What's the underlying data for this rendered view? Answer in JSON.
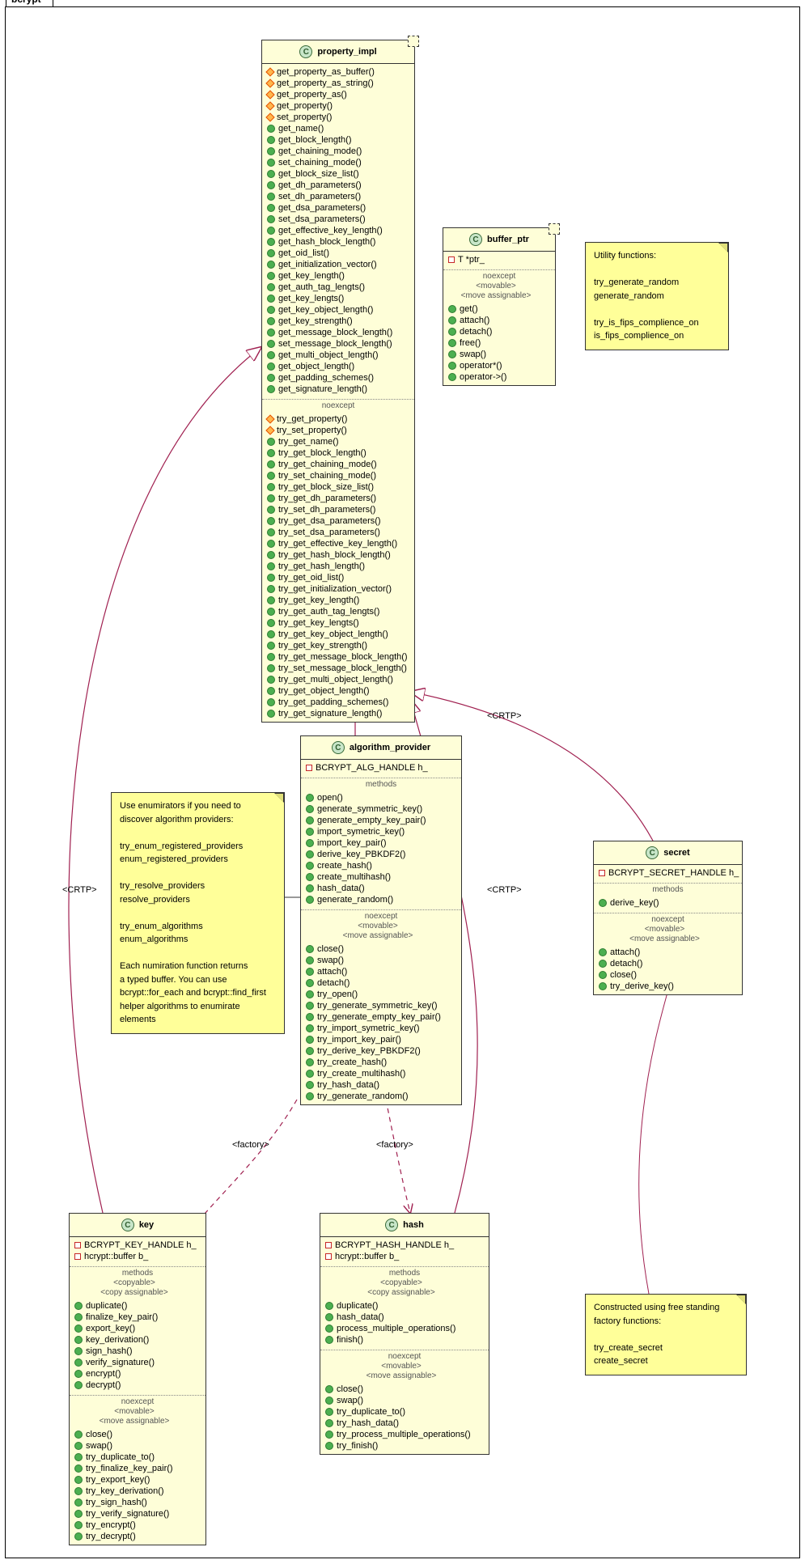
{
  "package": {
    "name": "bcrypt"
  },
  "classes": {
    "property_impl": {
      "name": "property_impl",
      "members1": [
        {
          "v": "protected",
          "t": "get_property_as_buffer()"
        },
        {
          "v": "protected",
          "t": "get_property_as_string()"
        },
        {
          "v": "protected",
          "t": "get_property_as()"
        },
        {
          "v": "protected",
          "t": "get_property()"
        },
        {
          "v": "protected",
          "t": "set_property()"
        },
        {
          "v": "public",
          "t": "get_name()"
        },
        {
          "v": "public",
          "t": "get_block_length()"
        },
        {
          "v": "public",
          "t": "get_chaining_mode()"
        },
        {
          "v": "public",
          "t": "set_chaining_mode()"
        },
        {
          "v": "public",
          "t": "get_block_size_list()"
        },
        {
          "v": "public",
          "t": "get_dh_parameters()"
        },
        {
          "v": "public",
          "t": "set_dh_parameters()"
        },
        {
          "v": "public",
          "t": "get_dsa_parameters()"
        },
        {
          "v": "public",
          "t": "set_dsa_parameters()"
        },
        {
          "v": "public",
          "t": "get_effective_key_length()"
        },
        {
          "v": "public",
          "t": "get_hash_block_length()"
        },
        {
          "v": "public",
          "t": "get_oid_list()"
        },
        {
          "v": "public",
          "t": "get_initialization_vector()"
        },
        {
          "v": "public",
          "t": "get_key_length()"
        },
        {
          "v": "public",
          "t": "get_auth_tag_lengts()"
        },
        {
          "v": "public",
          "t": "get_key_lengts()"
        },
        {
          "v": "public",
          "t": "get_key_object_length()"
        },
        {
          "v": "public",
          "t": "get_key_strength()"
        },
        {
          "v": "public",
          "t": "get_message_block_length()"
        },
        {
          "v": "public",
          "t": "set_message_block_length()"
        },
        {
          "v": "public",
          "t": "get_multi_object_length()"
        },
        {
          "v": "public",
          "t": "get_object_length()"
        },
        {
          "v": "public",
          "t": "get_padding_schemes()"
        },
        {
          "v": "public",
          "t": "get_signature_length()"
        }
      ],
      "sec1_label": "noexcept",
      "members2": [
        {
          "v": "protected",
          "t": "try_get_property()"
        },
        {
          "v": "protected",
          "t": "try_set_property()"
        },
        {
          "v": "public",
          "t": "try_get_name()"
        },
        {
          "v": "public",
          "t": "try_get_block_length()"
        },
        {
          "v": "public",
          "t": "try_get_chaining_mode()"
        },
        {
          "v": "public",
          "t": "try_set_chaining_mode()"
        },
        {
          "v": "public",
          "t": "try_get_block_size_list()"
        },
        {
          "v": "public",
          "t": "try_get_dh_parameters()"
        },
        {
          "v": "public",
          "t": "try_set_dh_parameters()"
        },
        {
          "v": "public",
          "t": "try_get_dsa_parameters()"
        },
        {
          "v": "public",
          "t": "try_set_dsa_parameters()"
        },
        {
          "v": "public",
          "t": "try_get_effective_key_length()"
        },
        {
          "v": "public",
          "t": "try_get_hash_block_length()"
        },
        {
          "v": "public",
          "t": "try_get_hash_length()"
        },
        {
          "v": "public",
          "t": "try_get_oid_list()"
        },
        {
          "v": "public",
          "t": "try_get_initialization_vector()"
        },
        {
          "v": "public",
          "t": "try_get_key_length()"
        },
        {
          "v": "public",
          "t": "try_get_auth_tag_lengts()"
        },
        {
          "v": "public",
          "t": "try_get_key_lengts()"
        },
        {
          "v": "public",
          "t": "try_get_key_object_length()"
        },
        {
          "v": "public",
          "t": "try_get_key_strength()"
        },
        {
          "v": "public",
          "t": "try_get_message_block_length()"
        },
        {
          "v": "public",
          "t": "try_set_message_block_length()"
        },
        {
          "v": "public",
          "t": "try_get_multi_object_length()"
        },
        {
          "v": "public",
          "t": "try_get_object_length()"
        },
        {
          "v": "public",
          "t": "try_get_padding_schemes()"
        },
        {
          "v": "public",
          "t": "try_get_signature_length()"
        }
      ]
    },
    "buffer_ptr": {
      "name": "buffer_ptr",
      "attrs": [
        {
          "v": "private",
          "t": "T *ptr_"
        }
      ],
      "sec_label": "noexcept",
      "stereo": [
        "<movable>",
        "<move assignable>"
      ],
      "methods": [
        {
          "v": "public",
          "t": "get()"
        },
        {
          "v": "public",
          "t": "attach()"
        },
        {
          "v": "public",
          "t": "detach()"
        },
        {
          "v": "public",
          "t": "free()"
        },
        {
          "v": "public",
          "t": "swap()"
        },
        {
          "v": "public",
          "t": "operator*()"
        },
        {
          "v": "public",
          "t": "operator->()"
        }
      ]
    },
    "algorithm_provider": {
      "name": "algorithm_provider",
      "attrs": [
        {
          "v": "private",
          "t": "BCRYPT_ALG_HANDLE h_"
        }
      ],
      "sec1_label": "methods",
      "methods1": [
        {
          "v": "public",
          "t": "open()"
        },
        {
          "v": "public",
          "t": "generate_symmetric_key()"
        },
        {
          "v": "public",
          "t": "generate_empty_key_pair()"
        },
        {
          "v": "public",
          "t": "import_symetric_key()"
        },
        {
          "v": "public",
          "t": "import_key_pair()"
        },
        {
          "v": "public",
          "t": "derive_key_PBKDF2()"
        },
        {
          "v": "public",
          "t": "create_hash()"
        },
        {
          "v": "public",
          "t": "create_multihash()"
        },
        {
          "v": "public",
          "t": "hash_data()"
        },
        {
          "v": "public",
          "t": "generate_random()"
        }
      ],
      "sec2_label": "noexcept",
      "stereo": [
        "<movable>",
        "<move assignable>"
      ],
      "methods2": [
        {
          "v": "public",
          "t": "close()"
        },
        {
          "v": "public",
          "t": "swap()"
        },
        {
          "v": "public",
          "t": "attach()"
        },
        {
          "v": "public",
          "t": "detach()"
        },
        {
          "v": "public",
          "t": "try_open()"
        },
        {
          "v": "public",
          "t": "try_generate_symmetric_key()"
        },
        {
          "v": "public",
          "t": "try_generate_empty_key_pair()"
        },
        {
          "v": "public",
          "t": "try_import_symetric_key()"
        },
        {
          "v": "public",
          "t": "try_import_key_pair()"
        },
        {
          "v": "public",
          "t": "try_derive_key_PBKDF2()"
        },
        {
          "v": "public",
          "t": "try_create_hash()"
        },
        {
          "v": "public",
          "t": "try_create_multihash()"
        },
        {
          "v": "public",
          "t": "try_hash_data()"
        },
        {
          "v": "public",
          "t": "try_generate_random()"
        }
      ]
    },
    "secret": {
      "name": "secret",
      "attrs": [
        {
          "v": "private",
          "t": "BCRYPT_SECRET_HANDLE h_"
        }
      ],
      "sec1_label": "methods",
      "methods1": [
        {
          "v": "public",
          "t": "derive_key()"
        }
      ],
      "sec2_label": "noexcept",
      "stereo": [
        "<movable>",
        "<move assignable>"
      ],
      "methods2": [
        {
          "v": "public",
          "t": "attach()"
        },
        {
          "v": "public",
          "t": "detach()"
        },
        {
          "v": "public",
          "t": "close()"
        },
        {
          "v": "public",
          "t": "try_derive_key()"
        }
      ]
    },
    "key": {
      "name": "key",
      "attrs": [
        {
          "v": "private",
          "t": "BCRYPT_KEY_HANDLE h_"
        },
        {
          "v": "private",
          "t": "hcrypt::buffer b_"
        }
      ],
      "sec1_label": "methods",
      "stereo1": [
        "<copyable>",
        "<copy assignable>"
      ],
      "methods1": [
        {
          "v": "public",
          "t": "duplicate()"
        },
        {
          "v": "public",
          "t": "finalize_key_pair()"
        },
        {
          "v": "public",
          "t": "export_key()"
        },
        {
          "v": "public",
          "t": "key_derivation()"
        },
        {
          "v": "public",
          "t": "sign_hash()"
        },
        {
          "v": "public",
          "t": "verify_signature()"
        },
        {
          "v": "public",
          "t": "encrypt()"
        },
        {
          "v": "public",
          "t": "decrypt()"
        }
      ],
      "sec2_label": "noexcept",
      "stereo2": [
        "<movable>",
        "<move assignable>"
      ],
      "methods2": [
        {
          "v": "public",
          "t": "close()"
        },
        {
          "v": "public",
          "t": "swap()"
        },
        {
          "v": "public",
          "t": "try_duplicate_to()"
        },
        {
          "v": "public",
          "t": "try_finalize_key_pair()"
        },
        {
          "v": "public",
          "t": "try_export_key()"
        },
        {
          "v": "public",
          "t": "try_key_derivation()"
        },
        {
          "v": "public",
          "t": "try_sign_hash()"
        },
        {
          "v": "public",
          "t": "try_verify_signature()"
        },
        {
          "v": "public",
          "t": "try_encrypt()"
        },
        {
          "v": "public",
          "t": "try_decrypt()"
        }
      ]
    },
    "hash": {
      "name": "hash",
      "attrs": [
        {
          "v": "private",
          "t": "BCRYPT_HASH_HANDLE h_"
        },
        {
          "v": "private",
          "t": "hcrypt::buffer b_"
        }
      ],
      "sec1_label": "methods",
      "stereo1": [
        "<copyable>",
        "<copy assignable>"
      ],
      "methods1": [
        {
          "v": "public",
          "t": "duplicate()"
        },
        {
          "v": "public",
          "t": "hash_data()"
        },
        {
          "v": "public",
          "t": "process_multiple_operations()"
        },
        {
          "v": "public",
          "t": "finish()"
        }
      ],
      "sec2_label": "noexcept",
      "stereo2": [
        "<movable>",
        "<move assignable>"
      ],
      "methods2": [
        {
          "v": "public",
          "t": "close()"
        },
        {
          "v": "public",
          "t": "swap()"
        },
        {
          "v": "public",
          "t": "try_duplicate_to()"
        },
        {
          "v": "public",
          "t": "try_hash_data()"
        },
        {
          "v": "public",
          "t": "try_process_multiple_operations()"
        },
        {
          "v": "public",
          "t": "try_finish()"
        }
      ]
    }
  },
  "notes": {
    "utility": "Utility functions:\n\ntry_generate_random\ngenerate_random\n\ntry_is_fips_complience_on\nis_fips_complience_on",
    "enumerators": "Use enumirators if you need to\ndiscover algorithm providers:\n\ntry_enum_registered_providers\nenum_registered_providers\n\ntry_resolve_providers\nresolve_providers\n\ntry_enum_algorithms\nenum_algorithms\n\nEach numiration function returns\na typed buffer. You can use\nbcrypt::for_each and bcrypt::find_first\nhelper algorithms to enumirate elements",
    "secret_note": "Constructed using free standing\nfactory functions:\n\ntry_create_secret\ncreate_secret"
  },
  "edges": {
    "crtp": "<CRTP>",
    "factory": "<factory>"
  }
}
